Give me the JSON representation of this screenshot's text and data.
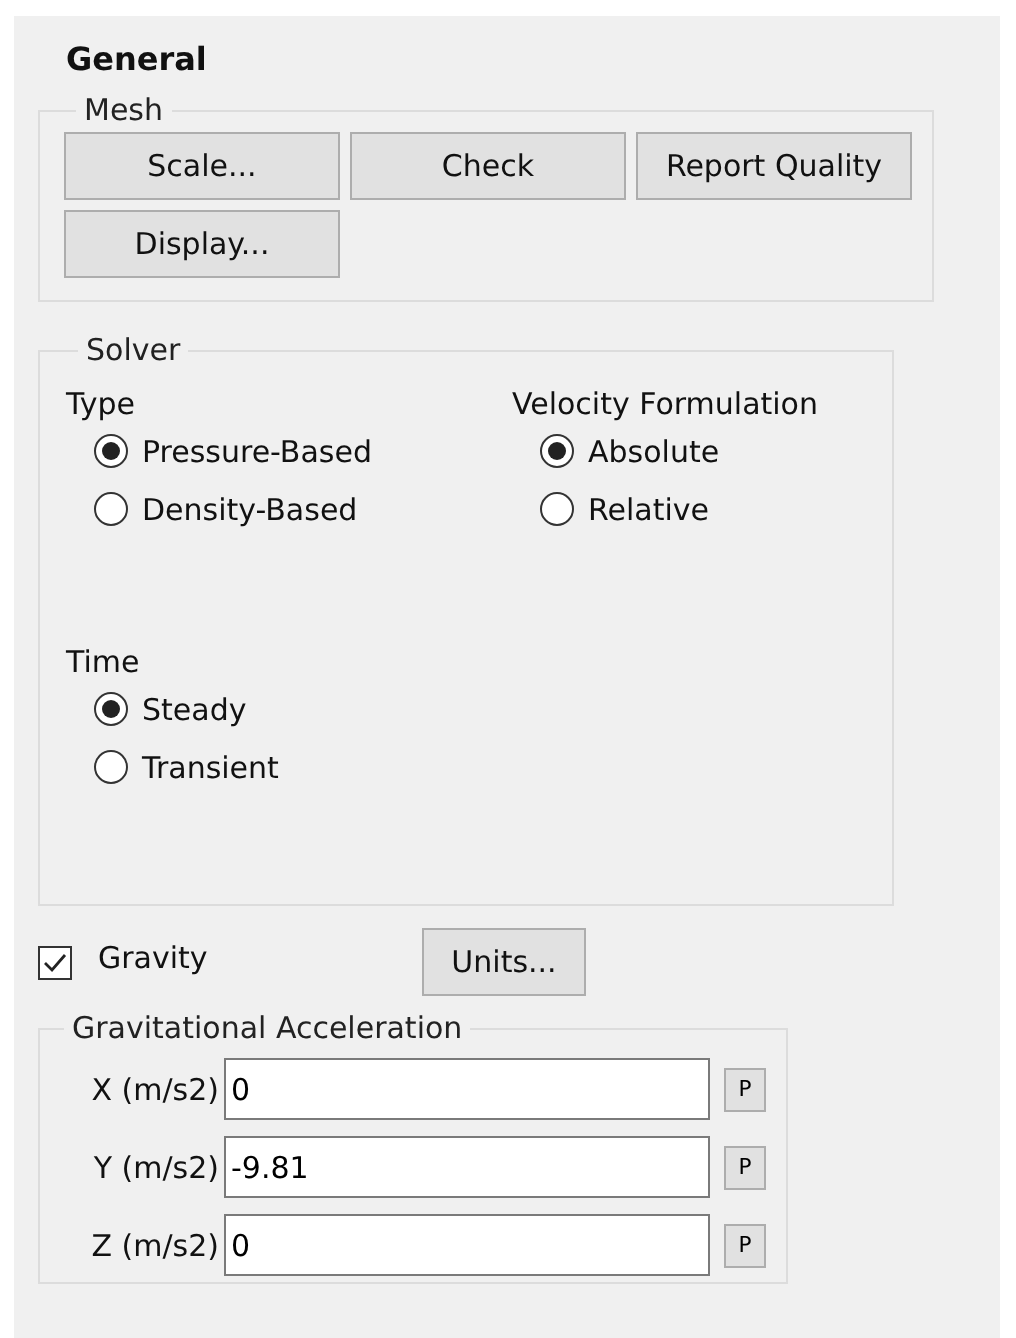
{
  "panel": {
    "title": "General"
  },
  "mesh": {
    "title": "Mesh",
    "buttons": [
      "Scale...",
      "Check",
      "Report Quality",
      "Display..."
    ]
  },
  "solver": {
    "title": "Solver",
    "groups": [
      {
        "label": "Type",
        "options": [
          {
            "label": "Pressure-Based",
            "selected": true
          },
          {
            "label": "Density-Based",
            "selected": false
          }
        ]
      },
      {
        "label": "Velocity Formulation",
        "options": [
          {
            "label": "Absolute",
            "selected": true
          },
          {
            "label": "Relative",
            "selected": false
          }
        ]
      },
      {
        "label": "Time",
        "options": [
          {
            "label": "Steady",
            "selected": true
          },
          {
            "label": "Transient",
            "selected": false
          }
        ]
      }
    ]
  },
  "gravity": {
    "label": "Gravity",
    "checked": true,
    "units_button": "Units..."
  },
  "acceleration": {
    "title": "Gravitational Acceleration",
    "rows": [
      {
        "label": "X (m/s2)",
        "value": "0",
        "param_button": "P"
      },
      {
        "label": "Y (m/s2)",
        "value": "-9.81",
        "param_button": "P"
      },
      {
        "label": "Z (m/s2)",
        "value": "0",
        "param_button": "P"
      }
    ]
  }
}
